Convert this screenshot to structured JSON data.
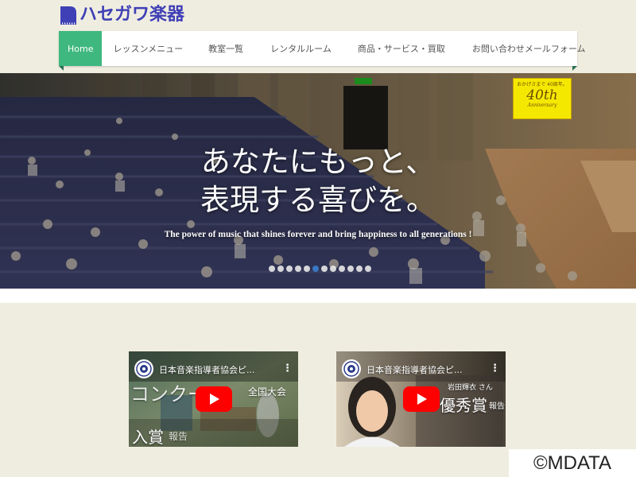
{
  "site": {
    "logo_text": "ハセガワ楽器"
  },
  "nav": {
    "items": [
      {
        "label": "Home",
        "active": true
      },
      {
        "label": "レッスンメニュー"
      },
      {
        "label": "教室一覧"
      },
      {
        "label": "レンタルルーム"
      },
      {
        "label": "商品・サービス・買取"
      },
      {
        "label": "お問い合わせメールフォーム"
      }
    ]
  },
  "hero": {
    "title_line1": "あなたにもっと、",
    "title_line2": "表現する喜びを。",
    "subtitle": "The power of music that shines forever and bring happiness to all generations !",
    "slide_count": 12,
    "active_slide": 5,
    "badge": {
      "small_text": "おかげさまで 40周年。",
      "main_text": "40th",
      "sub_text": "Anniversary",
      "color": "#f5e800"
    }
  },
  "videos": [
    {
      "title": "日本音楽指導者協会ピ...",
      "overlay_text_1": "コンクール",
      "overlay_text_2": "全国大会",
      "overlay_text_3": "入賞",
      "overlay_text_4": "報告"
    },
    {
      "title": "日本音楽指導者協会ピ...",
      "overlay_text_1": "優秀賞",
      "overlay_text_2": "報告",
      "overlay_text_3": "岩田輝衣 さん"
    }
  ],
  "copyright": "©MDATA",
  "colors": {
    "background": "#efede0",
    "nav_active": "#3fb87f",
    "logo": "#3f3fb6",
    "youtube_red": "#ff0000"
  }
}
